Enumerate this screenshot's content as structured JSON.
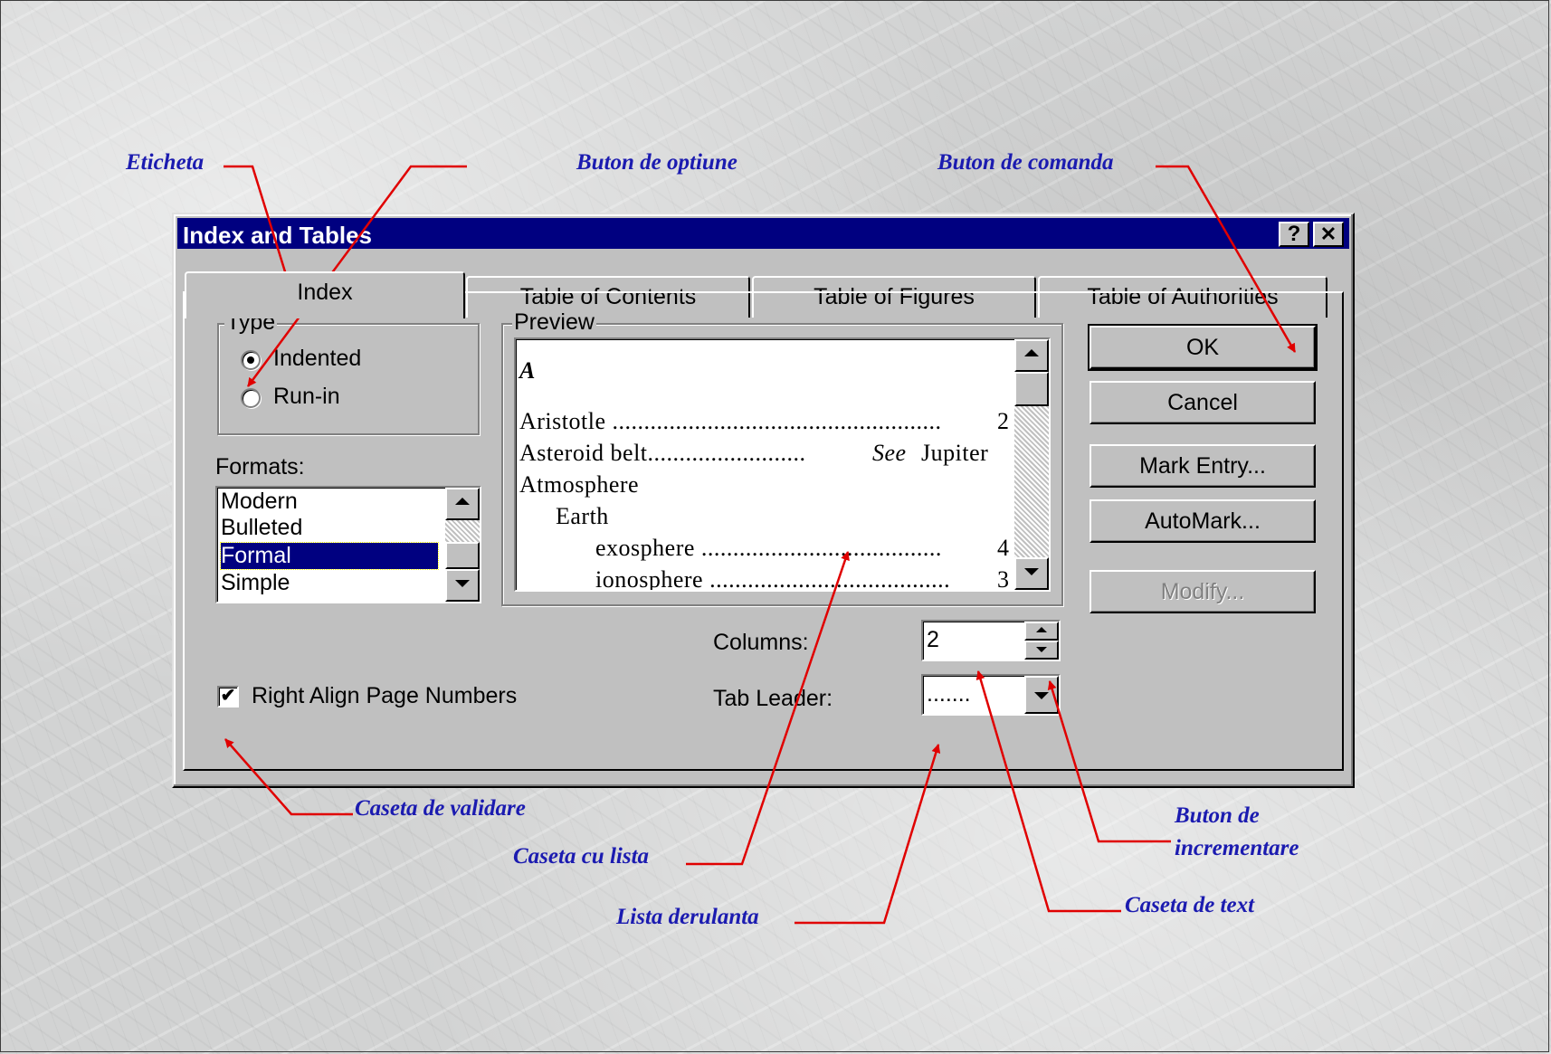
{
  "callouts": {
    "eticheta": "Eticheta",
    "buton_optiune": "Buton de optiune",
    "buton_comanda": "Buton de comanda",
    "caseta_validare": "Caseta de validare",
    "buton_incrementare_line1": "Buton de",
    "buton_incrementare_line2": "incrementare",
    "caseta_lista": "Caseta cu lista",
    "caseta_text": "Caseta de text",
    "lista_derulanta": "Lista derulanta"
  },
  "callout_color": "#1b1bb0",
  "arrow_color": "#e00000",
  "dialog": {
    "title": "Index and Tables",
    "help_label": "?",
    "close_label": "✕",
    "title_bar_color": "#000080",
    "tabs": [
      {
        "label": "Index"
      },
      {
        "label": "Table of Contents"
      },
      {
        "label": "Table of Figures"
      },
      {
        "label": "Table of Authorities"
      }
    ],
    "type_group": {
      "label": "Type",
      "options": [
        {
          "label": "Indented",
          "selected": true
        },
        {
          "label": "Run-in",
          "selected": false
        }
      ]
    },
    "formats": {
      "label": "Formats:",
      "items": [
        "Modern",
        "Bulleted",
        "Formal",
        "Simple"
      ],
      "selected": "Formal"
    },
    "preview": {
      "label": "Preview",
      "letter": "A",
      "lines": [
        {
          "text": "Aristotle ....................................................",
          "page": "2"
        },
        {
          "text": "Asteroid belt.........................",
          "see": "See",
          "target": "Jupiter"
        },
        {
          "text": "Atmosphere"
        },
        {
          "text": "Earth"
        },
        {
          "text": "exosphere ......................................",
          "page": "4"
        },
        {
          "text": "ionosphere ......................................",
          "page": "3"
        }
      ]
    },
    "buttons": {
      "ok": "OK",
      "cancel": "Cancel",
      "mark_entry": "Mark Entry...",
      "automark": "AutoMark...",
      "modify": "Modify..."
    },
    "columns": {
      "label": "Columns:",
      "value": "2"
    },
    "tab_leader": {
      "label": "Tab Leader:",
      "value": "......."
    },
    "right_align": {
      "label": "Right Align Page Numbers",
      "checked": true,
      "mark": "✔"
    }
  }
}
